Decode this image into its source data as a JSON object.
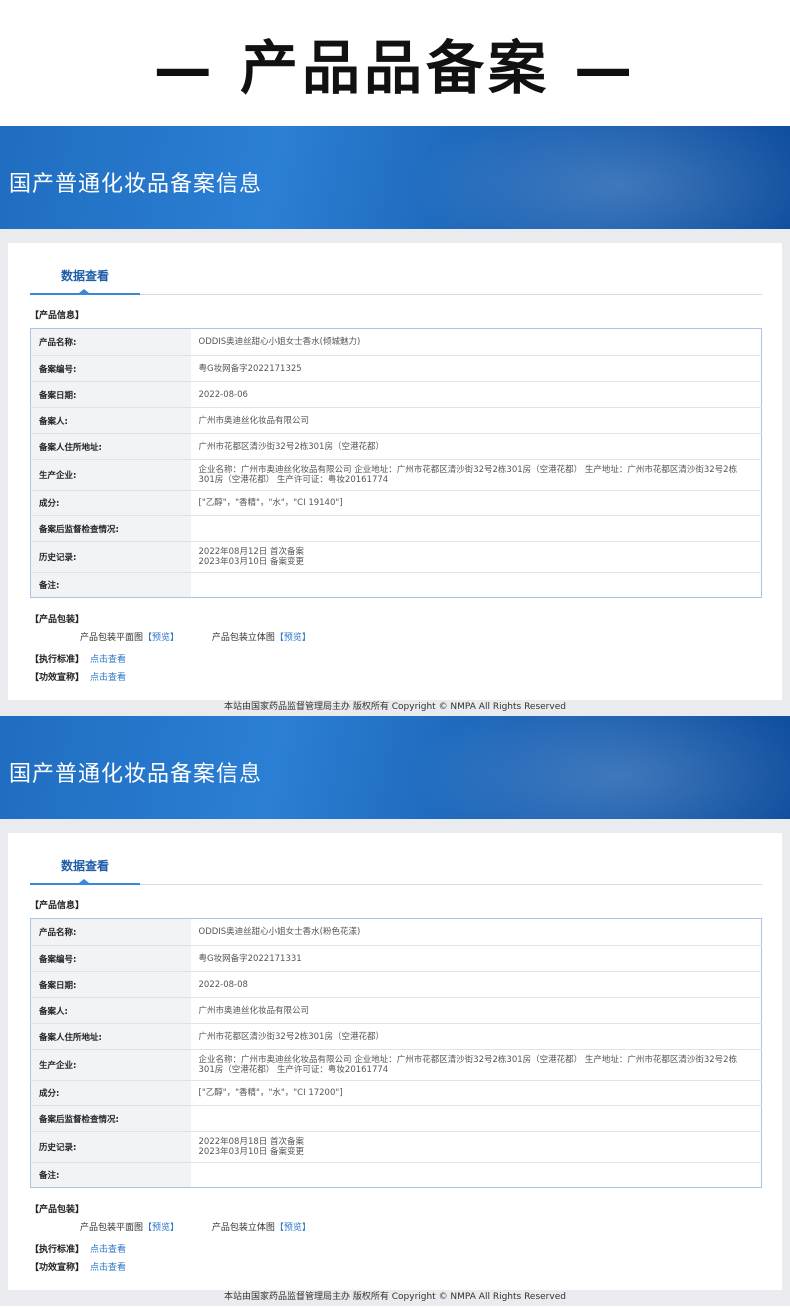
{
  "page_title": "— 产品品备案 —",
  "banner_title": "国产普通化妆品备案信息",
  "tab_label": "数据查看",
  "labels": {
    "product_info": "【产品信息】",
    "package": "【产品包装】",
    "package_flat": "产品包装平面图",
    "package_3d": "产品包装立体图",
    "preview": "【预览】",
    "standard": "【执行标准】",
    "efficacy": "【功效宣称】",
    "click_view": "点击查看"
  },
  "field_names": [
    "产品名称:",
    "备案编号:",
    "备案日期:",
    "备案人:",
    "备案人住所地址:",
    "生产企业:",
    "成分:",
    "备案后监督检查情况:",
    "历史记录:",
    "备注:"
  ],
  "records": [
    {
      "product_name": "ODDIS奥迪丝甜心小姐女士香水(倾城魅力)",
      "record_no": "粤G妆网备字2022171325",
      "record_date": "2022-08-06",
      "registrant": "广州市奥迪丝化妆品有限公司",
      "address": "广州市花都区清沙街32号2栋301房（空港花都）",
      "manufacturer": "企业名称：广州市奥迪丝化妆品有限公司 企业地址：广州市花都区清沙街32号2栋301房（空港花都） 生产地址：广州市花都区清沙街32号2栋301房（空港花都） 生产许可证：粤妆20161774",
      "ingredients": "[\"乙醇\"，\"香精\"，\"水\"，\"CI 19140\"]",
      "inspection": "",
      "history_1": "2022年08月12日 首次备案",
      "history_2": "2023年03月10日 备案变更",
      "remark": ""
    },
    {
      "product_name": "ODDIS奥迪丝甜心小姐女士香水(粉色花漾)",
      "record_no": "粤G妆网备字2022171331",
      "record_date": "2022-08-08",
      "registrant": "广州市奥迪丝化妆品有限公司",
      "address": "广州市花都区清沙街32号2栋301房（空港花都）",
      "manufacturer": "企业名称：广州市奥迪丝化妆品有限公司 企业地址：广州市花都区清沙街32号2栋301房（空港花都） 生产地址：广州市花都区清沙街32号2栋301房（空港花都） 生产许可证：粤妆20161774",
      "ingredients": "[\"乙醇\"，\"香精\"，\"水\"，\"CI 17200\"]",
      "inspection": "",
      "history_1": "2022年08月18日 首次备案",
      "history_2": "2023年03月10日 备案变更",
      "remark": ""
    }
  ],
  "footer": "本站由国家药品监督管理局主办 版权所有 Copyright © NMPA All Rights Reserved"
}
